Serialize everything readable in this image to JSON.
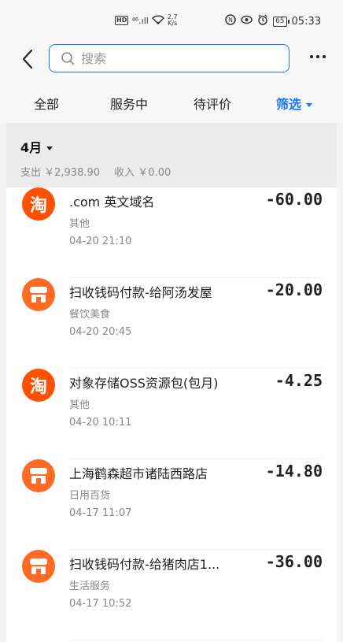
{
  "status_bar": {
    "hd": "HD",
    "signal": "⁴⁶.ıll",
    "speed_value": "2.7",
    "speed_unit": "K/s",
    "battery": "65",
    "time": "05:33"
  },
  "search": {
    "placeholder": "搜索",
    "value": ""
  },
  "tabs": [
    {
      "label": "全部"
    },
    {
      "label": "服务中"
    },
    {
      "label": "待评价"
    },
    {
      "label": "筛选"
    }
  ],
  "month": {
    "label": "4月",
    "expense": "支出 ￥2,938.90",
    "income": "收入 ￥0.00"
  },
  "transactions": [
    {
      "icon": "taobao-icon",
      "icon_text": "淘",
      "title": ".com 英文域名",
      "category": "其他",
      "time": "04-20  21:10",
      "amount": "-60.00"
    },
    {
      "icon": "store-icon",
      "title": "扫收钱码付款-给阿汤发屋",
      "category": "餐饮美食",
      "time": "04-20  20:45",
      "amount": "-20.00"
    },
    {
      "icon": "taobao-icon",
      "icon_text": "淘",
      "title": "对象存储OSS资源包(包月)",
      "category": "其他",
      "time": "04-20  10:11",
      "amount": "-4.25"
    },
    {
      "icon": "store-icon",
      "title": "上海鹤森超市诸陆西路店",
      "category": "日用百货",
      "time": "04-17  11:07",
      "amount": "-14.80"
    },
    {
      "icon": "store-icon",
      "title": "扫收钱码付款-给猪肉店1...",
      "category": "生活服务",
      "time": "04-17  10:52",
      "amount": "-36.00"
    }
  ],
  "colors": {
    "accent": "#1677ff",
    "taobao": "#ff5000",
    "store": "#ff6a24"
  }
}
